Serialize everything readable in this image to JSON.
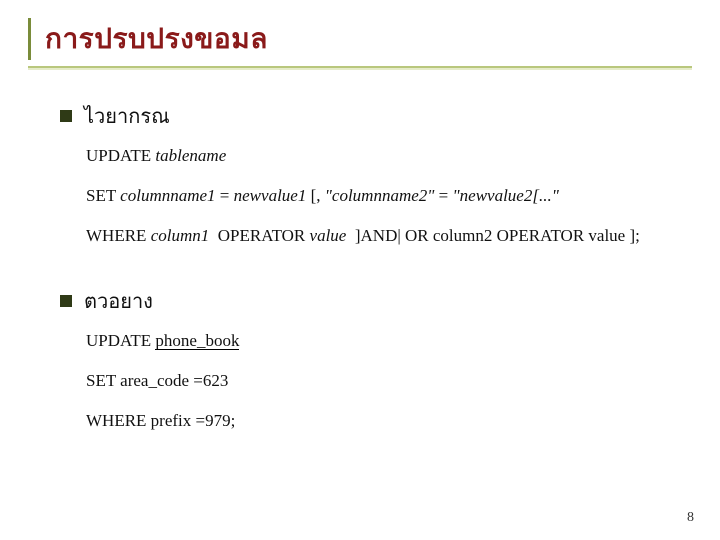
{
  "title": "การปรบปรงขอมล",
  "sections": [
    {
      "label": "ไวยากรณ",
      "lines": {
        "l1_a": "UPDATE",
        "l1_b": "tablename",
        "l2_a": "SET",
        "l2_b": "columnname1",
        "l2_c": "=",
        "l2_d": "newvalue1",
        "l2_e": "[,",
        "l2_f": "\"columnname2\"",
        "l2_g": "=",
        "l2_h": "\"newvalue2[...\"",
        "l3_a": "WHERE",
        "l3_b": "column1",
        "l3_c": "OPERATOR",
        "l3_d": "value",
        "l3_e": "]AND| OR column2 OPERATOR value ];"
      }
    },
    {
      "label": "ตวอยาง",
      "lines": {
        "e1_a": "UPDATE",
        "e1_b": "phone_book",
        "e2": "SET area_code =623",
        "e3": "WHERE prefix =979;"
      }
    }
  ],
  "page_number": "8"
}
